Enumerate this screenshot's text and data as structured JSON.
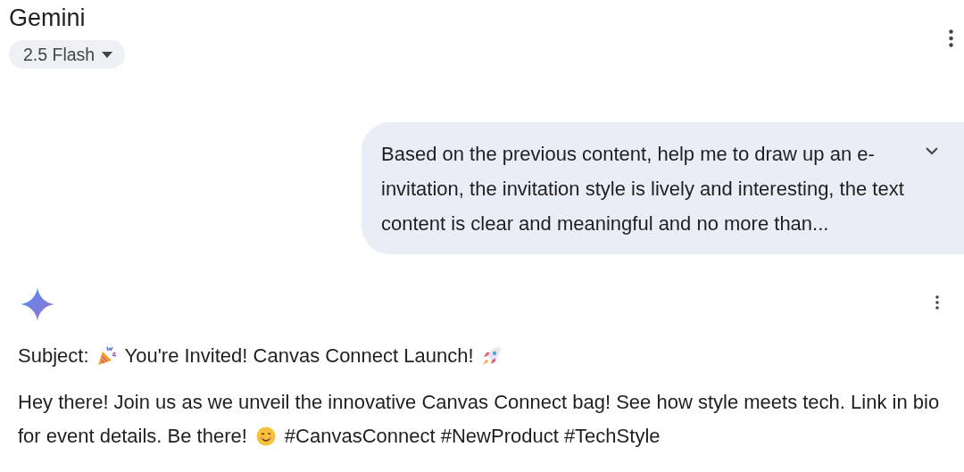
{
  "header": {
    "title": "Gemini",
    "model": "2.5 Flash"
  },
  "prompt": {
    "text": "Based on the previous content, help me to draw up an e-invitation, the invitation style is lively and interesting, the text content is clear and meaningful and no more than...",
    "expanded": false
  },
  "response": {
    "subject_label": "Subject:",
    "subject": "You're Invited! Canvas Connect Launch!",
    "body": [
      "Hey there! Join us as we unveil the innovative Canvas Connect bag! See how style meets tech. Link in bio",
      "for event details. Be there!"
    ],
    "hashtags": "#CanvasConnect #NewProduct #TechStyle"
  }
}
